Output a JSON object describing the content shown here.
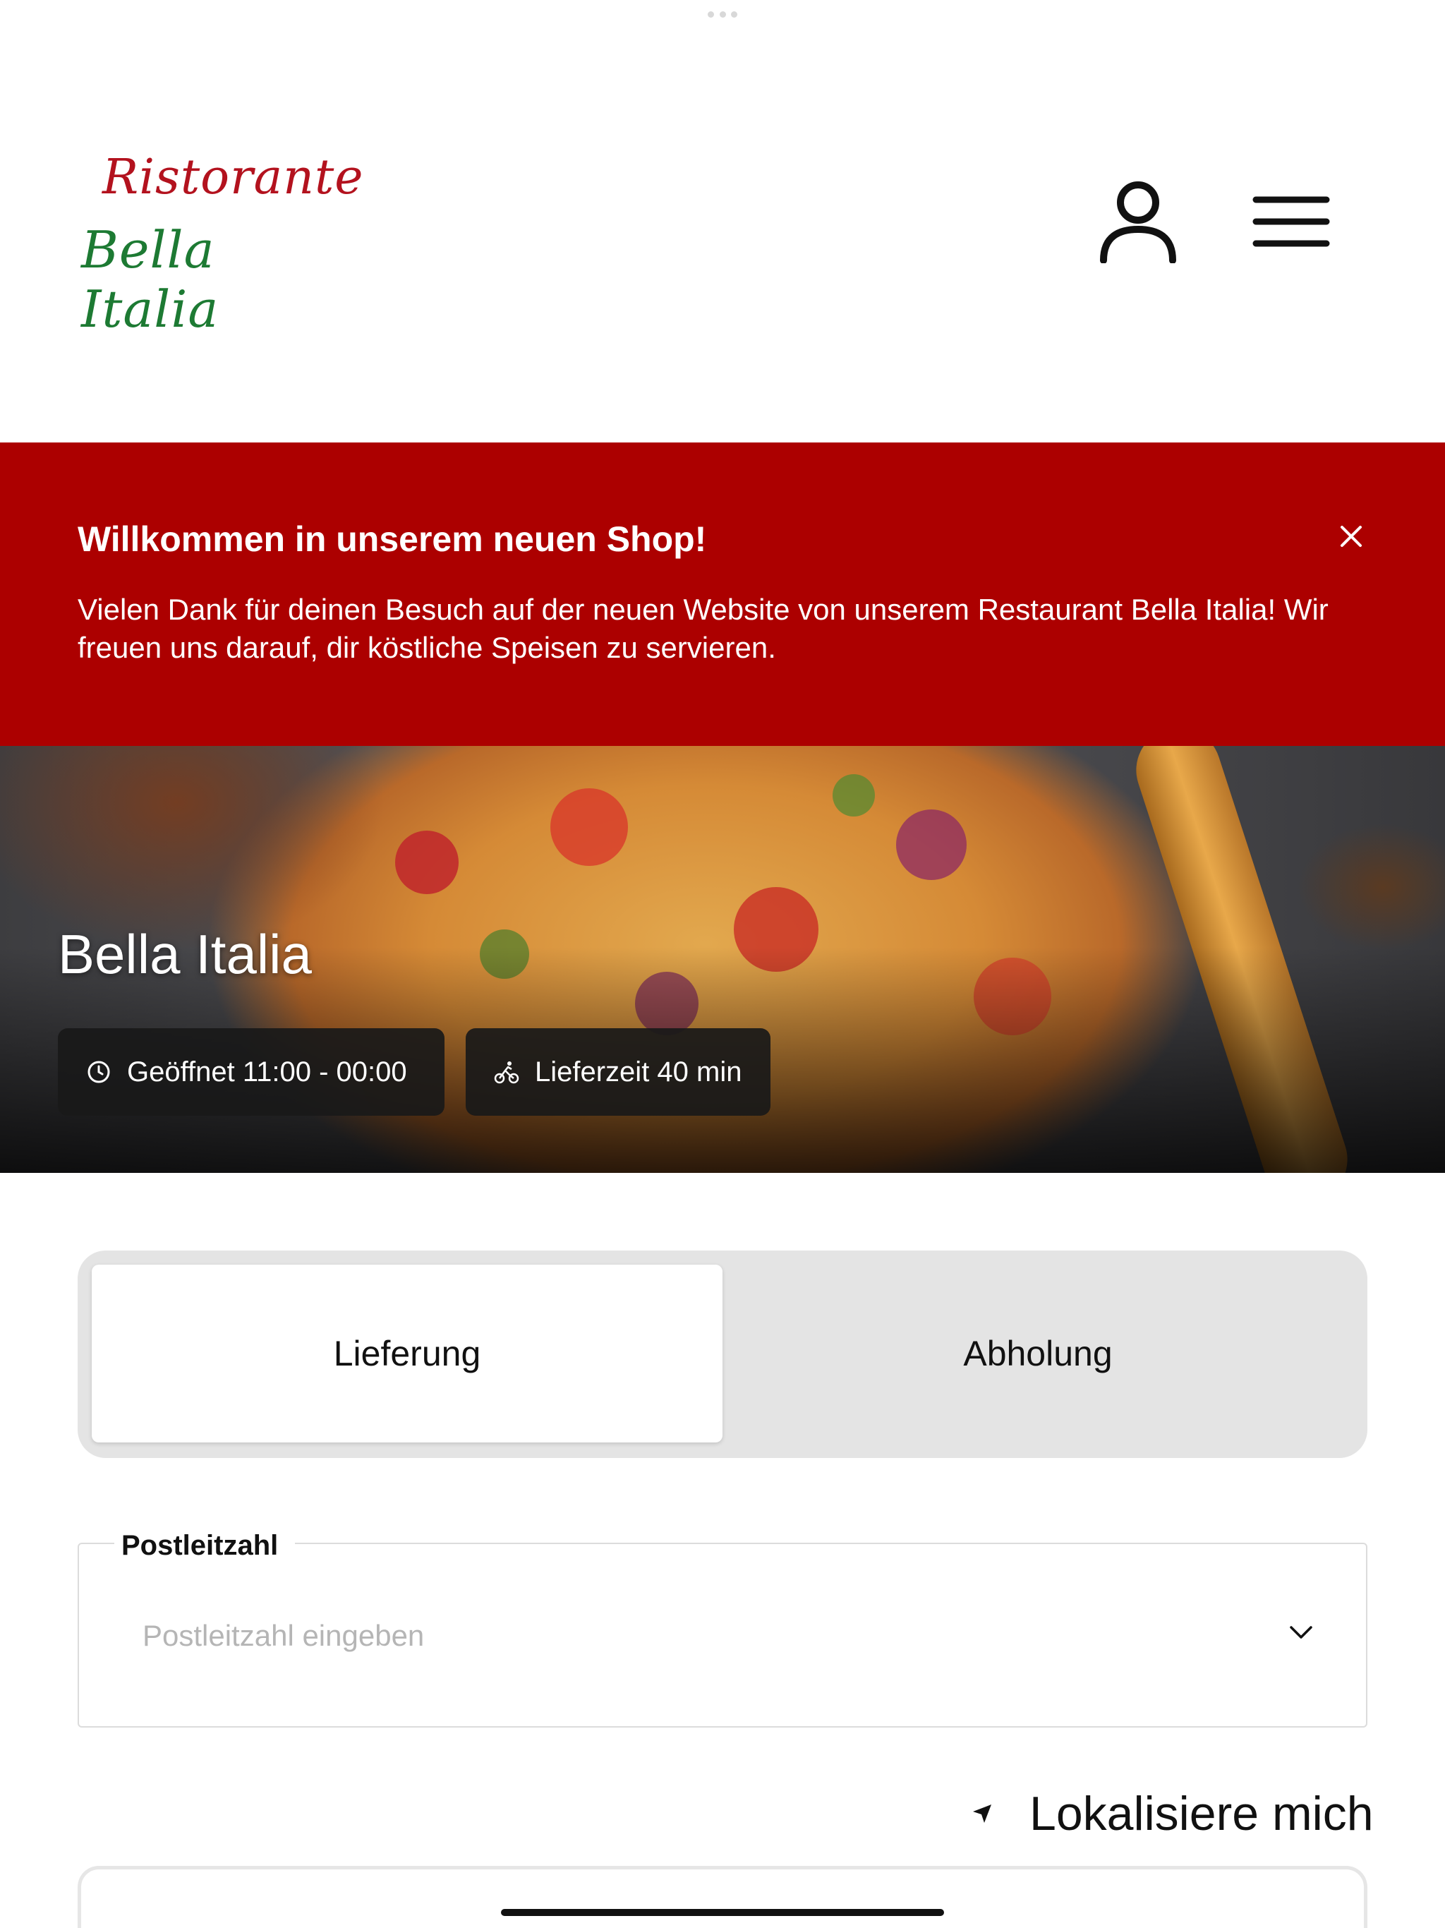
{
  "header": {
    "logo_line1": "Ristorante",
    "logo_line2": "Bella Italia",
    "icons": [
      "user-icon",
      "menu-icon"
    ]
  },
  "banner": {
    "title": "Willkommen in unserem neuen Shop!",
    "text": "Vielen Dank für deinen Besuch auf der neuen Website von unserem Restaurant Bella Italia! Wir freuen uns darauf, dir köstliche Speisen zu servieren.",
    "background": "#ac0000"
  },
  "hero": {
    "title": "Bella Italia",
    "hours_label": "Geöffnet 11:00 - 00:00",
    "delivery_label": "Lieferzeit 40 min"
  },
  "order_type": {
    "tabs": [
      {
        "label": "Lieferung",
        "active": true
      },
      {
        "label": "Abholung",
        "active": false
      }
    ]
  },
  "postal": {
    "label": "Postleitzahl",
    "placeholder": "Postleitzahl eingeben",
    "value": ""
  },
  "locate": {
    "label": "Lokalisiere mich"
  },
  "colors": {
    "accent_red": "#ac0000",
    "logo_red": "#b3121e",
    "logo_green": "#1d7a33"
  }
}
